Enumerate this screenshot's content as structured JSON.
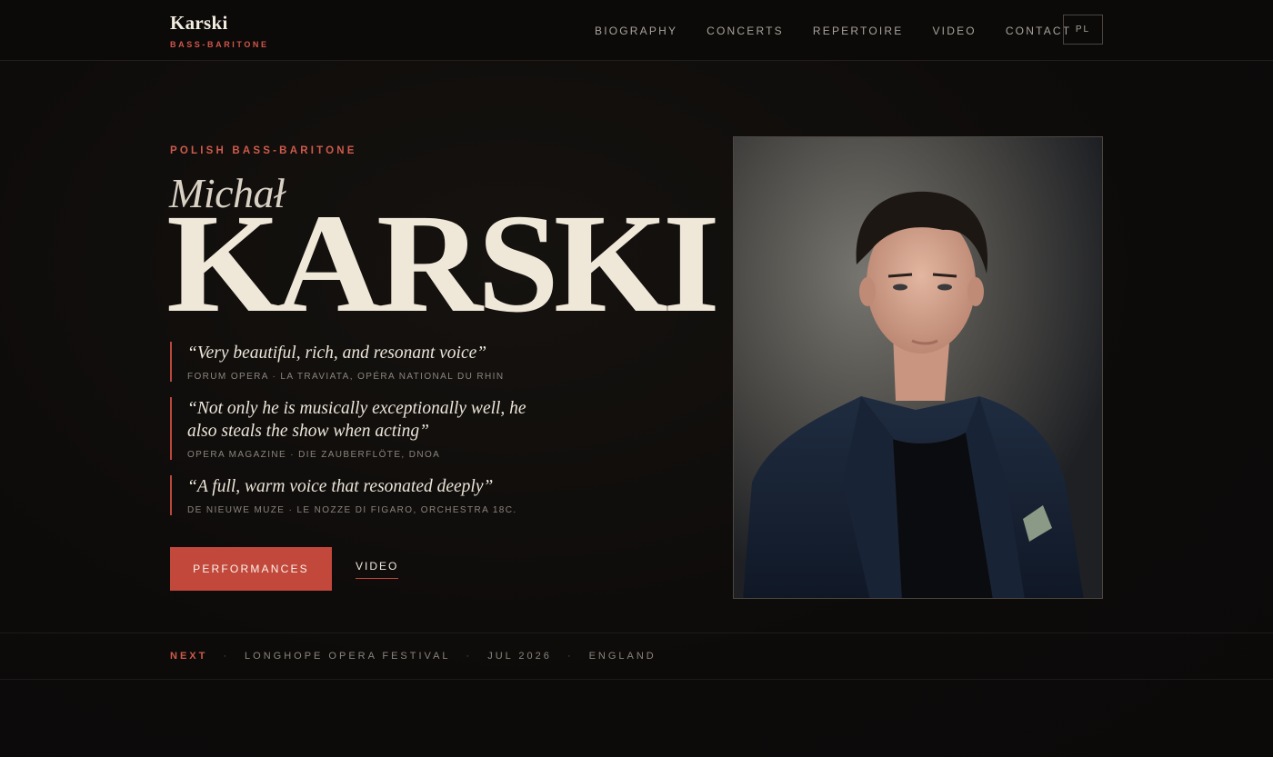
{
  "header": {
    "brand_name": "Karski",
    "brand_sub": "BASS-BARITONE",
    "nav": [
      "BIOGRAPHY",
      "CONCERTS",
      "REPERTOIRE",
      "VIDEO",
      "CONTACT"
    ],
    "lang": "PL"
  },
  "hero": {
    "eyebrow": "POLISH BASS-BARITONE",
    "first_name": "Michał",
    "last_name": "KARSKI",
    "quotes": [
      {
        "text": "“Very beautiful, rich, and resonant voice”",
        "source": "FORUM OPERA · LA TRAVIATA, OPÉRA NATIONAL DU RHIN"
      },
      {
        "text": "“Not only he is musically exceptionally well, he also steals the show when acting”",
        "source": "OPERA MAGAZINE · DIE ZAUBERFLÖTE, DNOA"
      },
      {
        "text": "“A full, warm voice that resonated deeply”",
        "source": "DE NIEUWE MUZE · LE NOZZE DI FIGARO, ORCHESTRA 18C."
      }
    ],
    "primary_button": "PERFORMANCES",
    "secondary_link": "VIDEO"
  },
  "next": {
    "label": "NEXT",
    "event": "LONGHOPE OPERA FESTIVAL",
    "date": "JUL 2026",
    "location": "ENGLAND"
  },
  "colors": {
    "accent": "#c2483b",
    "background": "#0d0b0a",
    "text": "#efe8dc"
  }
}
